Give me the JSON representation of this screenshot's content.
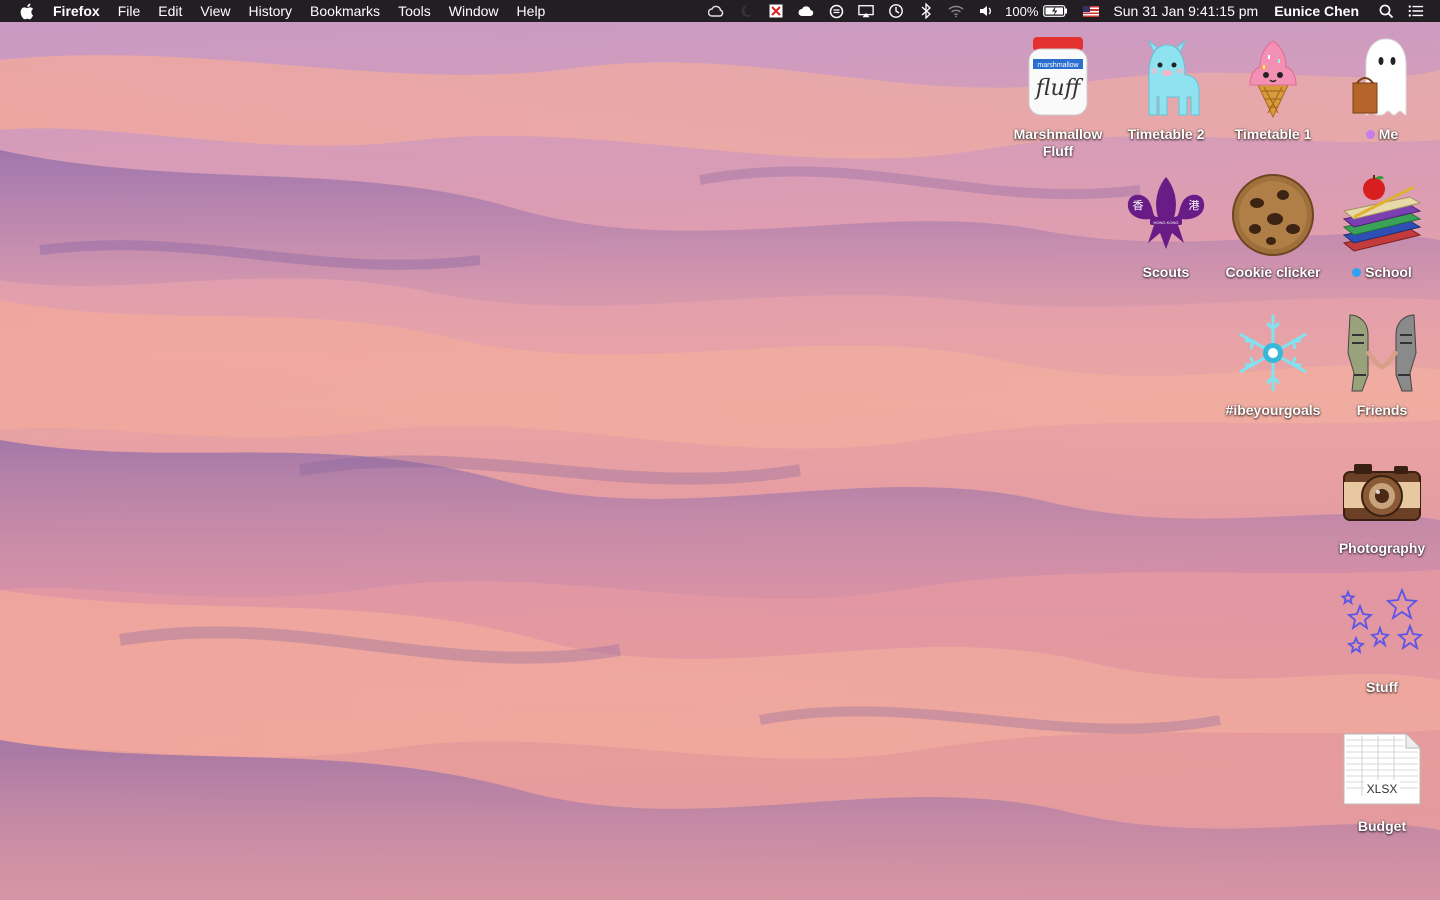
{
  "menubar": {
    "app_name": "Firefox",
    "menus": [
      "File",
      "Edit",
      "View",
      "History",
      "Bookmarks",
      "Tools",
      "Window",
      "Help"
    ],
    "battery": "100%",
    "clock": "Sun 31 Jan  9:41:15 pm",
    "user": "Eunice Chen",
    "status_icons": [
      "creative-cloud-icon",
      "moon-icon",
      "x-box-icon",
      "cloud-icon",
      "circle-icon",
      "airplay-icon",
      "time-machine-icon",
      "bluetooth-icon",
      "wifi-icon",
      "volume-icon",
      "battery-icon",
      "us-flag-icon",
      "spotlight-icon",
      "notification-center-icon"
    ]
  },
  "desktop": {
    "icons": [
      {
        "label": "Marshmallow Fluff",
        "image": "marshmallow-fluff-jar",
        "jar_text": "fluff",
        "jar_lid_text": "marshmallow",
        "tag_color": null
      },
      {
        "label": "Timetable 2",
        "image": "blue-llama",
        "tag_color": null
      },
      {
        "label": "Timetable 1",
        "image": "ice-cream-cone",
        "tag_color": null
      },
      {
        "label": "Me",
        "image": "ghost-with-bag",
        "tag_color": "#c67ee8"
      },
      {
        "label": "Scouts",
        "image": "hong-kong-scouts-fleur-de-lis",
        "emblem_text": [
          "香",
          "港",
          "HONG KONG"
        ],
        "tag_color": null
      },
      {
        "label": "Cookie clicker",
        "image": "chocolate-chip-cookie",
        "tag_color": null
      },
      {
        "label": "School",
        "image": "books-with-apple",
        "tag_color": "#2ea3f2"
      },
      {
        "label": "#ibeyourgoals",
        "image": "snowflake",
        "tag_color": null
      },
      {
        "label": "Friends",
        "image": "friends-holding-hands",
        "tag_color": null
      },
      {
        "label": "Photography",
        "image": "vintage-camera",
        "tag_color": null
      },
      {
        "label": "Stuff",
        "image": "stars",
        "tag_color": null
      },
      {
        "label": "Budget",
        "image": "xlsx-document",
        "file_type": "XLSX",
        "tag_color": null
      }
    ]
  }
}
